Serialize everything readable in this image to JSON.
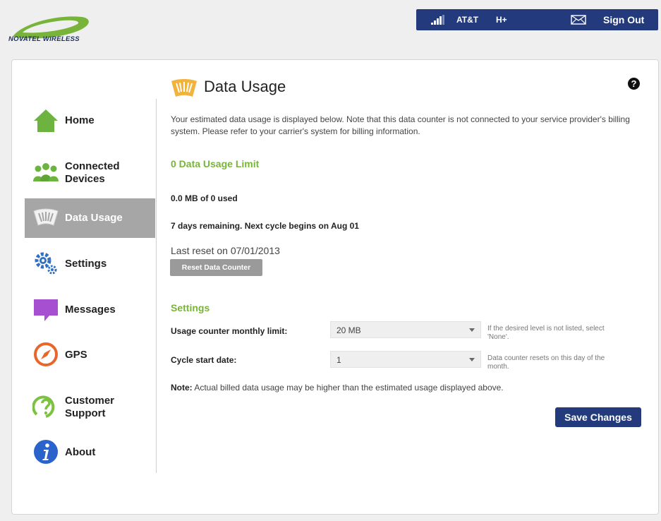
{
  "brand": {
    "logo_text": "NOVATEL WIRELESS"
  },
  "status_bar": {
    "carrier": "AT&T",
    "network": "H+",
    "sign_out_label": "Sign Out"
  },
  "sidebar": {
    "items": [
      {
        "label": "Home",
        "icon": "home-icon",
        "active": false
      },
      {
        "label": "Connected Devices",
        "icon": "connected-devices-icon",
        "active": false
      },
      {
        "label": "Data Usage",
        "icon": "data-usage-icon",
        "active": true
      },
      {
        "label": "Settings",
        "icon": "settings-gear-icon",
        "active": false
      },
      {
        "label": "Messages",
        "icon": "messages-icon",
        "active": false
      },
      {
        "label": "GPS",
        "icon": "gps-compass-icon",
        "active": false
      },
      {
        "label": "Customer Support",
        "icon": "customer-support-icon",
        "active": false
      },
      {
        "label": "About",
        "icon": "about-info-icon",
        "active": false
      }
    ]
  },
  "main": {
    "title": "Data Usage",
    "description": "Your estimated data usage is displayed below. Note that this data counter is not connected to your service provider's billing system. Please refer to your carrier's system for billing information.",
    "limit_heading": "0 Data Usage Limit",
    "usage_text": "0.0 MB of 0 used",
    "cycle_text": "7 days remaining. Next cycle begins on Aug 01",
    "last_reset_text": "Last reset on 07/01/2013",
    "reset_button_label": "Reset Data Counter",
    "settings_heading": "Settings",
    "monthly_limit": {
      "label": "Usage counter monthly limit:",
      "value": "20 MB",
      "help": "If the desired level is not listed, select 'None'."
    },
    "cycle_start": {
      "label": "Cycle start date:",
      "value": "1",
      "help": "Data counter resets on this day of the month."
    },
    "note_label": "Note:",
    "note_text": "Actual billed data usage may be higher than the estimated usage displayed above.",
    "save_button_label": "Save Changes"
  },
  "colors": {
    "navy": "#233b7c",
    "green": "#79b43a",
    "active_nav": "#a6a6a6",
    "gray_button": "#9a9a9a"
  }
}
